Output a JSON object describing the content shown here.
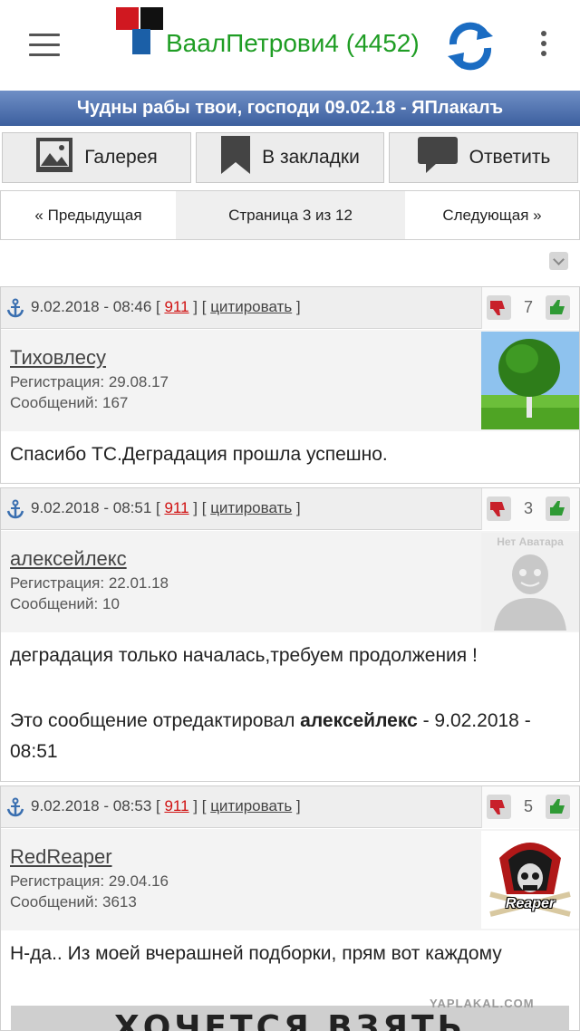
{
  "header": {
    "user_title": "ВаалПетрови4 (4452)",
    "colors": {
      "title_green": "#1f9d24",
      "logo_red": "#d01820",
      "logo_blue": "#1b5fa7",
      "logo_black": "#111111"
    },
    "icons": [
      "menu-icon",
      "logo-icon",
      "refresh-icon",
      "more-vert-icon"
    ]
  },
  "thread": {
    "title": "Чудны рабы твои, господи 09.02.18 - ЯПлакалъ"
  },
  "actions": {
    "gallery": "Галерея",
    "bookmark": "В закладки",
    "reply": "Ответить"
  },
  "pager": {
    "prev": "« Предыдущая",
    "current": "Страница 3 из 12",
    "next": "Следующая »"
  },
  "posts": [
    {
      "date": "9.02.2018 - 08:46",
      "number": "911",
      "quote": "цитировать",
      "votes": "7",
      "author": "Тиховлесу",
      "registration": "Регистрация: 29.08.17",
      "messages": "Сообщений: 167",
      "avatar": "tree-photo",
      "body": "Спасибо ТС.Деградация прошла успешно."
    },
    {
      "date": "9.02.2018 - 08:51",
      "number": "911",
      "quote": "цитировать",
      "votes": "3",
      "author": "алексейлекс",
      "registration": "Регистрация: 22.01.18",
      "messages": "Сообщений: 10",
      "avatar_label": "Нет Аватара",
      "body": "деградация только началась,требуем продолжения !",
      "edit_prefix": "Это сообщение отредактировал",
      "edit_author": "алексейлекс",
      "edit_suffix": "- 9.02.2018 - 08:51"
    },
    {
      "date": "9.02.2018 - 08:53",
      "number": "911",
      "quote": "цитировать",
      "votes": "5",
      "author": "RedReaper",
      "registration": "Регистрация: 29.04.16",
      "messages": "Сообщений: 3613",
      "avatar_label": "Reaper",
      "body": "Н-да.. Из моей вчерашней подборки, прям вот каждому"
    }
  ],
  "bottom_image_text": "ХОЧЕТСЯ ВЗЯТЬ",
  "watermark": "YAPLAKAL.COM"
}
